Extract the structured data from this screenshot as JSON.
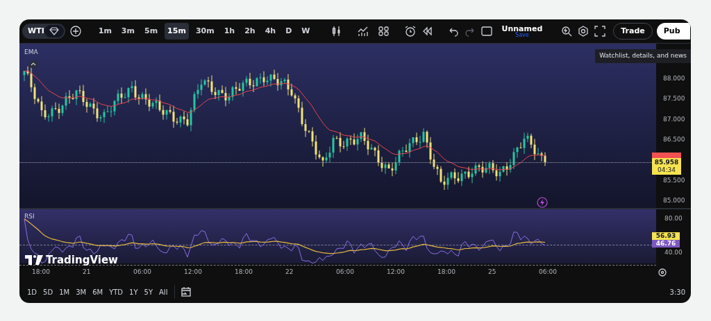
{
  "toolbar": {
    "symbol": "WTI",
    "intervals": [
      {
        "label": "1m",
        "selected": false
      },
      {
        "label": "3m",
        "selected": false
      },
      {
        "label": "5m",
        "selected": false
      },
      {
        "label": "15m",
        "selected": true
      },
      {
        "label": "30m",
        "selected": false
      },
      {
        "label": "1h",
        "selected": false
      },
      {
        "label": "2h",
        "selected": false
      },
      {
        "label": "4h",
        "selected": false
      },
      {
        "label": "D",
        "selected": false
      },
      {
        "label": "W",
        "selected": false
      }
    ],
    "layout_name": "Unnamed",
    "layout_status": "Save",
    "trade_button": "Trade",
    "publish_button": "Pub"
  },
  "main_pane": {
    "indicator": "EMA",
    "tooltip": "Watchlist, details, and news",
    "price_ticks": [
      "88.000",
      "87.500",
      "87.000",
      "86.500",
      "85.500",
      "85.000"
    ],
    "last_price": "85.958",
    "countdown": "04:34"
  },
  "rsi_pane": {
    "indicator": "RSI",
    "ticks": [
      "80.00",
      "40.00"
    ],
    "rsi_value": "46.76",
    "ma_value": "56.93"
  },
  "watermark_brand": "TradingView",
  "time_axis": [
    "18:00",
    "21",
    "06:00",
    "12:00",
    "18:00",
    "22",
    "06:00",
    "12:00",
    "18:00",
    "25",
    "06:00"
  ],
  "bottom_bar": {
    "ranges": [
      "1D",
      "5D",
      "1M",
      "3M",
      "6M",
      "YTD",
      "1Y",
      "5Y",
      "All"
    ],
    "clock": "3:30"
  }
}
